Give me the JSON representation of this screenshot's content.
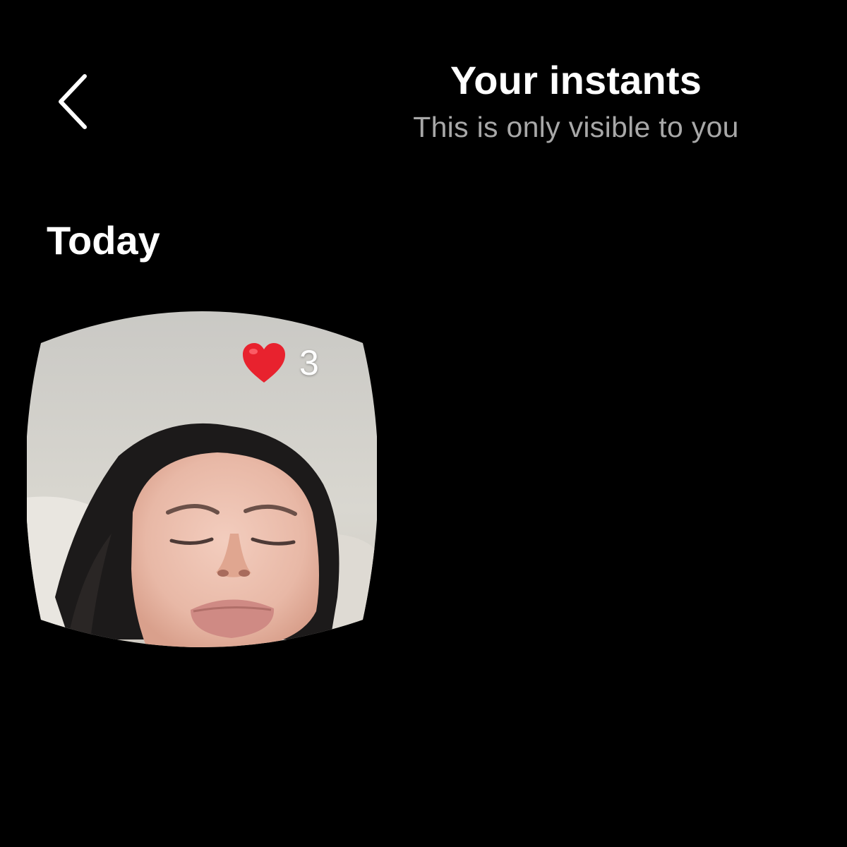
{
  "header": {
    "back_icon": "chevron-left-icon",
    "title": "Your instants",
    "subtitle": "This is only visible to you"
  },
  "sections": [
    {
      "label": "Today",
      "instants": [
        {
          "reaction_icon": "red-heart-icon",
          "reaction_count": "3"
        }
      ]
    }
  ],
  "colors": {
    "background": "#000000",
    "title": "#ffffff",
    "subtitle": "#a8a8a8",
    "heart": "#e8222e"
  }
}
